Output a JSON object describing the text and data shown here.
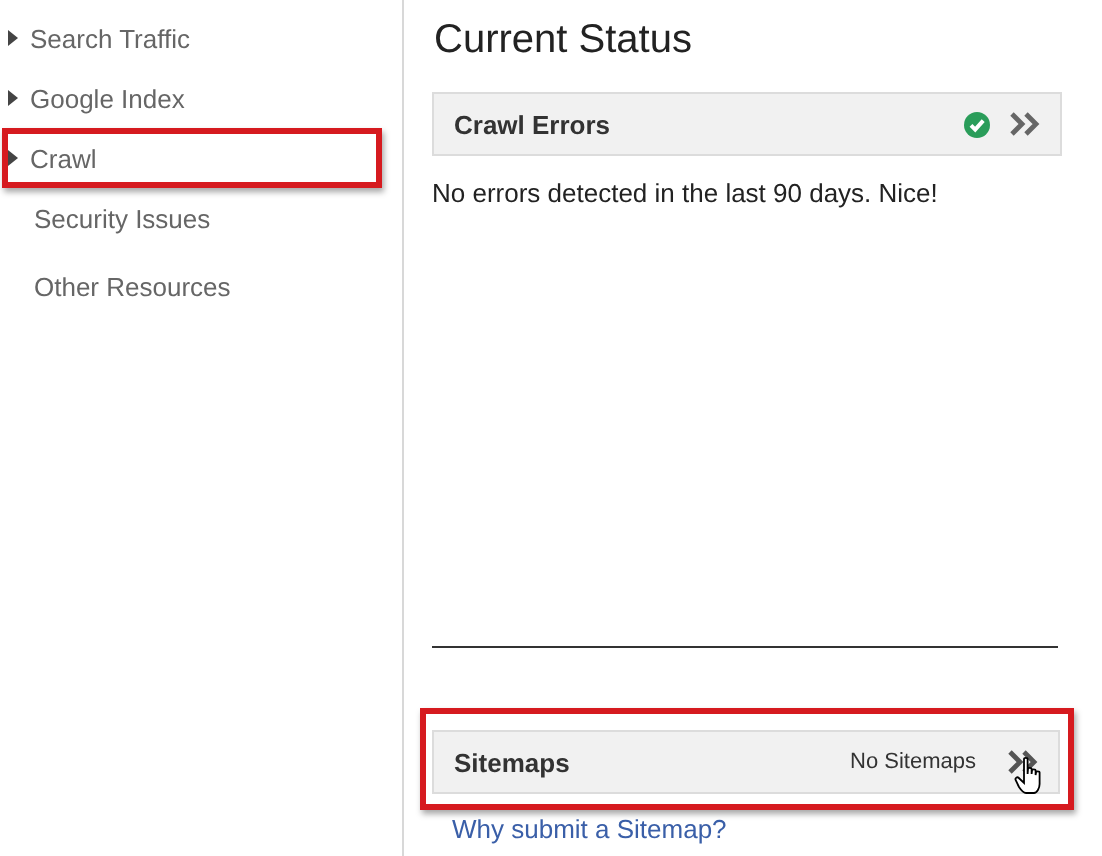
{
  "sidebar": {
    "items": [
      {
        "label": "Search Traffic",
        "kind": "group",
        "highlighted": false
      },
      {
        "label": "Google Index",
        "kind": "group",
        "highlighted": false
      },
      {
        "label": "Crawl",
        "kind": "group",
        "highlighted": true
      },
      {
        "label": "Security Issues",
        "kind": "link",
        "highlighted": false
      },
      {
        "label": "Other Resources",
        "kind": "link",
        "highlighted": false
      }
    ]
  },
  "main": {
    "title": "Current Status",
    "crawl_errors": {
      "title": "Crawl Errors",
      "ok": true,
      "message": "No errors detected in the last 90 days. Nice!"
    },
    "sitemaps": {
      "title": "Sitemaps",
      "status": "No Sitemaps",
      "highlighted": true,
      "link": "Why submit a Sitemap?"
    }
  }
}
